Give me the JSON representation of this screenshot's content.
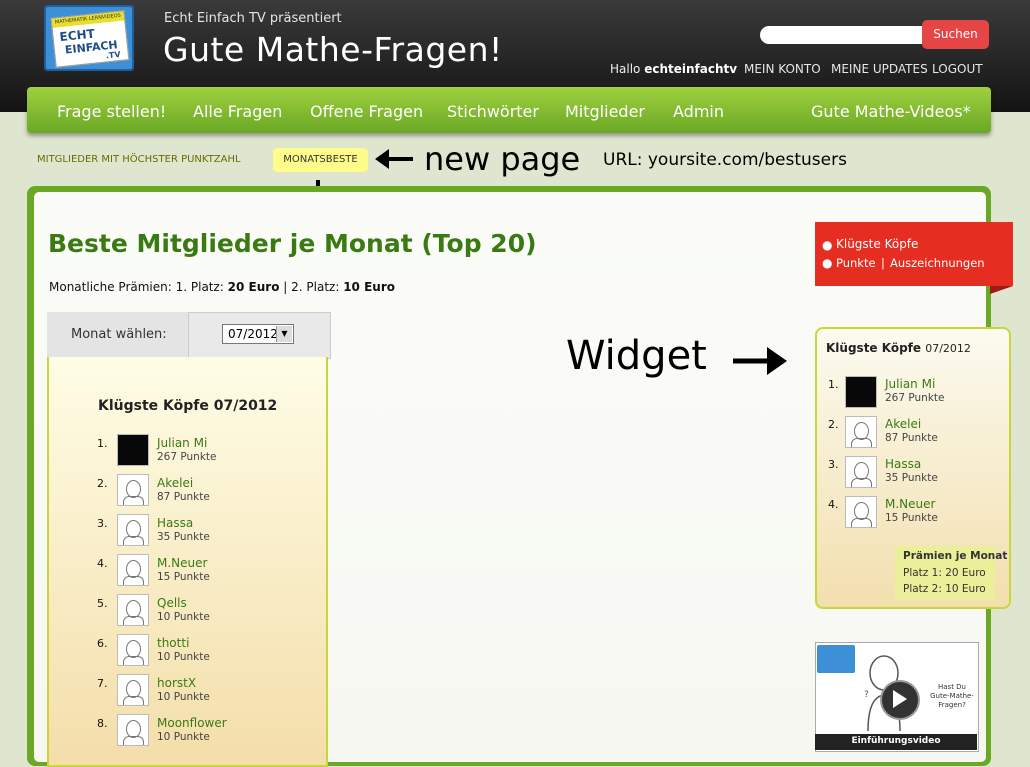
{
  "header": {
    "logo_lines": [
      "ECHT",
      "EINFACH",
      ".TV"
    ],
    "logo_banner": "MATHEMATIK LERNVIDEOS",
    "presents": "Echt Einfach TV präsentiert",
    "site_title": "Gute Mathe-Fragen!",
    "search_placeholder": "",
    "search_button": "Suchen",
    "greeting": "Hallo",
    "username": "echteinfachtv",
    "links": [
      "MEIN KONTO",
      "MEINE UPDATES",
      "LOGOUT"
    ]
  },
  "nav": {
    "items": [
      "Frage stellen!",
      "Alle Fragen",
      "Offene Fragen",
      "Stichwörter",
      "Mitglieder",
      "Admin"
    ],
    "right_item": "Gute Mathe-Videos*"
  },
  "subnav": {
    "leaderboard": "MITGLIEDER MIT HÖCHSTER PUNKTZAHL",
    "monthly": "MONATSBESTE"
  },
  "annotations": {
    "new_page": "new page",
    "url": "URL: yoursite.com/bestusers",
    "widget": "Widget"
  },
  "main": {
    "title": "Beste Mitglieder je Monat (Top 20)",
    "prizes_prefix": "Monatliche Prämien: 1. Platz:",
    "prize1": "20 Euro",
    "prizes_sep": "| 2. Platz:",
    "prize2": "10 Euro",
    "month_label": "Monat wählen:",
    "month_value": "07/2012",
    "list_title": "Klügste Köpfe 07/2012",
    "users": [
      {
        "rank": "1.",
        "name": "Julian Mi",
        "points": "267 Punkte",
        "avatar": "dark-photo"
      },
      {
        "rank": "2.",
        "name": "Akelei",
        "points": "87 Punkte",
        "avatar": "sketch"
      },
      {
        "rank": "3.",
        "name": "Hassa",
        "points": "35 Punkte",
        "avatar": "sketch"
      },
      {
        "rank": "4.",
        "name": "M.Neuer",
        "points": "15 Punkte",
        "avatar": "sketch"
      },
      {
        "rank": "5.",
        "name": "Qells",
        "points": "10 Punkte",
        "avatar": "sketch"
      },
      {
        "rank": "6.",
        "name": "thotti",
        "points": "10 Punkte",
        "avatar": "sketch"
      },
      {
        "rank": "7.",
        "name": "horstX",
        "points": "10 Punkte",
        "avatar": "sketch"
      },
      {
        "rank": "8.",
        "name": "Moonflower",
        "points": "10 Punkte",
        "avatar": "sketch"
      }
    ]
  },
  "sidebar": {
    "links": [
      "Klügste Köpfe",
      "Punkte",
      "Auszeichnungen"
    ],
    "separator": "|",
    "widget": {
      "title": "Klügste Köpfe",
      "month": "07/2012",
      "users": [
        {
          "rank": "1.",
          "name": "Julian Mi",
          "points": "267 Punkte",
          "avatar": "dark-photo"
        },
        {
          "rank": "2.",
          "name": "Akelei",
          "points": "87 Punkte",
          "avatar": "sketch"
        },
        {
          "rank": "3.",
          "name": "Hassa",
          "points": "35 Punkte",
          "avatar": "sketch"
        },
        {
          "rank": "4.",
          "name": "M.Neuer",
          "points": "15 Punkte",
          "avatar": "sketch"
        }
      ],
      "prize_title": "Prämien je Monat",
      "prize1": "Platz 1: 20 Euro",
      "prize2": "Platz 2: 10 Euro"
    },
    "video": {
      "question": "Hast Du Gute-Mathe-Fragen?",
      "caption": "Einführungsvideo"
    }
  },
  "colors": {
    "header_bg": "#1c1c1c",
    "nav_green": "#8cc63f",
    "title_green": "#3a7a13",
    "search_red": "#e64546",
    "highlight_yellow": "#fffc8c",
    "sidebar_red": "#e52d21"
  }
}
